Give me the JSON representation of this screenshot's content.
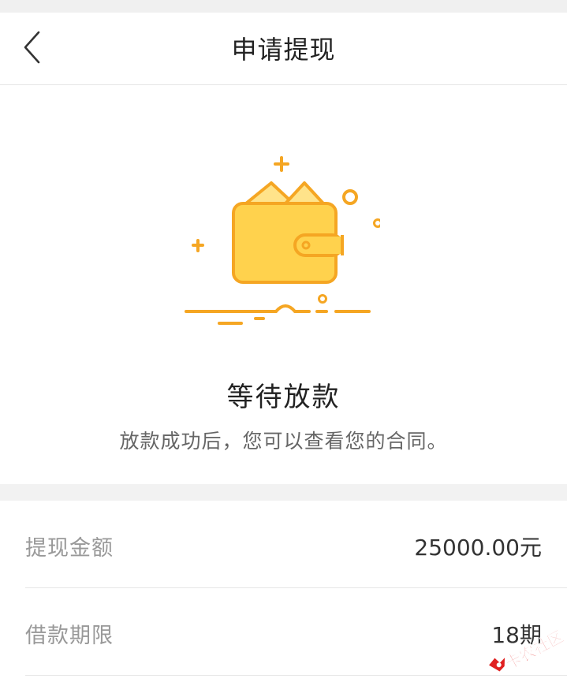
{
  "header": {
    "title": "申请提现"
  },
  "status": {
    "title": "等待放款",
    "description": "放款成功后，您可以查看您的合同。"
  },
  "details": [
    {
      "label": "提现金额",
      "value": "25000.00元"
    },
    {
      "label": "借款期限",
      "value": "18期"
    }
  ],
  "watermark": {
    "text": "卡农社区"
  },
  "colors": {
    "accent": "#f5a623",
    "wallet_fill": "#ffd24d",
    "wallet_stroke": "#f5a623",
    "background": "#f2f2f2"
  },
  "icons": {
    "back": "chevron-left-icon",
    "illustration": "wallet-icon"
  }
}
